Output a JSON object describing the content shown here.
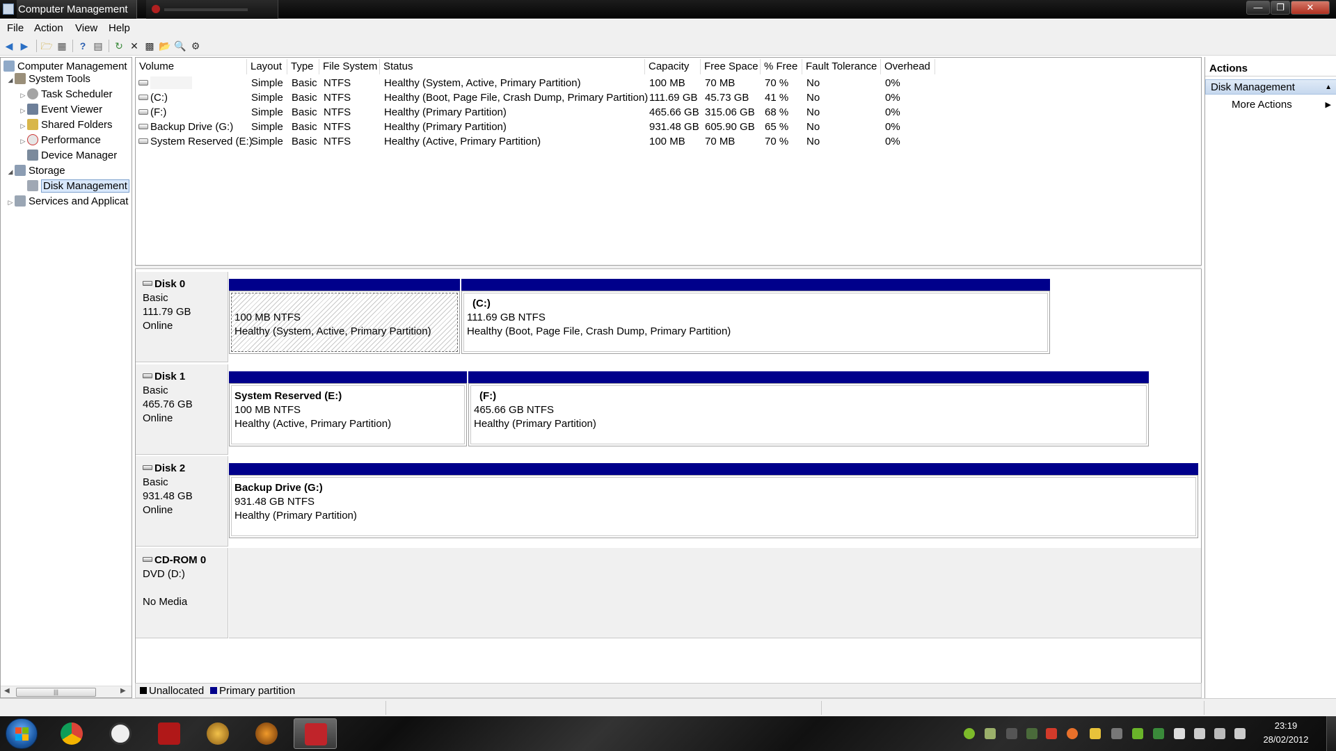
{
  "window": {
    "title": "Computer Management",
    "controls": [
      "minimize-icon",
      "maximize-icon",
      "close-icon"
    ]
  },
  "menu": [
    "File",
    "Action",
    "View",
    "Help"
  ],
  "toolbar": [
    "back-icon",
    "forward-icon",
    "up-folder-icon",
    "show-hide-tree-icon",
    "help-icon",
    "properties-icon",
    "refresh-icon",
    "delete-icon",
    "rescan-disks-icon",
    "open-icon",
    "search-icon",
    "settings-icon"
  ],
  "tree": [
    {
      "label": "Computer Management",
      "level": 0,
      "expander": "",
      "icon": "computer-management-icon"
    },
    {
      "label": "System Tools",
      "level": 1,
      "expander": "◢",
      "icon": "system-tools-icon"
    },
    {
      "label": "Task Scheduler",
      "level": 2,
      "expander": "▷",
      "icon": "task-scheduler-icon"
    },
    {
      "label": "Event Viewer",
      "level": 2,
      "expander": "▷",
      "icon": "event-viewer-icon"
    },
    {
      "label": "Shared Folders",
      "level": 2,
      "expander": "▷",
      "icon": "shared-folders-icon"
    },
    {
      "label": "Performance",
      "level": 2,
      "expander": "▷",
      "icon": "performance-icon"
    },
    {
      "label": "Device Manager",
      "level": 2,
      "expander": "",
      "icon": "device-manager-icon"
    },
    {
      "label": "Storage",
      "level": 1,
      "expander": "◢",
      "icon": "storage-icon"
    },
    {
      "label": "Disk Management",
      "level": 2,
      "expander": "",
      "icon": "disk-management-icon",
      "selected": true
    },
    {
      "label": "Services and Applicat",
      "level": 1,
      "expander": "▷",
      "icon": "services-icon"
    }
  ],
  "volume_table": {
    "columns": [
      "Volume",
      "Layout",
      "Type",
      "File System",
      "Status",
      "Capacity",
      "Free Space",
      "% Free",
      "Fault Tolerance",
      "Overhead"
    ],
    "rows": [
      [
        "",
        "Simple",
        "Basic",
        "NTFS",
        "Healthy (System, Active, Primary Partition)",
        "100 MB",
        "70 MB",
        "70 %",
        "No",
        "0%"
      ],
      [
        "(C:)",
        "Simple",
        "Basic",
        "NTFS",
        "Healthy (Boot, Page File, Crash Dump, Primary Partition)",
        "111.69 GB",
        "45.73 GB",
        "41 %",
        "No",
        "0%"
      ],
      [
        "(F:)",
        "Simple",
        "Basic",
        "NTFS",
        "Healthy (Primary Partition)",
        "465.66 GB",
        "315.06 GB",
        "68 %",
        "No",
        "0%"
      ],
      [
        "Backup Drive (G:)",
        "Simple",
        "Basic",
        "NTFS",
        "Healthy (Primary Partition)",
        "931.48 GB",
        "605.90 GB",
        "65 %",
        "No",
        "0%"
      ],
      [
        "System Reserved (E:)",
        "Simple",
        "Basic",
        "NTFS",
        "Healthy (Active, Primary Partition)",
        "100 MB",
        "70 MB",
        "70 %",
        "No",
        "0%"
      ]
    ]
  },
  "disks": [
    {
      "name": "Disk 0",
      "type": "Basic",
      "size": "111.79 GB",
      "status": "Online",
      "partitions": [
        {
          "name": "",
          "size": "100 MB NTFS",
          "status": "Healthy (System, Active, Primary Partition)",
          "hatched": true
        },
        {
          "name": "(C:)",
          "size": "111.69 GB NTFS",
          "status": "Healthy (Boot, Page File, Crash Dump, Primary Partition)"
        }
      ]
    },
    {
      "name": "Disk 1",
      "type": "Basic",
      "size": "465.76 GB",
      "status": "Online",
      "partitions": [
        {
          "name": "System Reserved  (E:)",
          "size": "100 MB NTFS",
          "status": "Healthy (Active, Primary Partition)"
        },
        {
          "name": "(F:)",
          "size": "465.66 GB NTFS",
          "status": "Healthy (Primary Partition)"
        }
      ]
    },
    {
      "name": "Disk 2",
      "type": "Basic",
      "size": "931.48 GB",
      "status": "Online",
      "partitions": [
        {
          "name": "Backup Drive  (G:)",
          "size": "931.48 GB NTFS",
          "status": "Healthy (Primary Partition)"
        }
      ]
    }
  ],
  "cdrom": {
    "name": "CD-ROM 0",
    "drive": "DVD (D:)",
    "status": "No Media"
  },
  "legend": [
    {
      "label": "Unallocated",
      "color": "#000000"
    },
    {
      "label": "Primary partition",
      "color": "#00008b"
    }
  ],
  "actions": {
    "header": "Actions",
    "section": "Disk Management",
    "items": [
      "More Actions"
    ]
  },
  "taskbar": {
    "apps": [
      "chrome-icon",
      "ubisoft-icon",
      "game-launcher-icon",
      "warcraft-icon",
      "game-icon",
      "computer-management-icon"
    ],
    "tray_icons": [
      "antivirus-icon",
      "network-monitor-icon",
      "keyboard-icon",
      "gpu-icon",
      "volume-app-icon",
      "firewall-icon",
      "camera-icon",
      "tools-icon",
      "nvidia-icon",
      "wifi-app-icon",
      "action-center-icon",
      "battery-icon",
      "network-icon",
      "speaker-icon"
    ],
    "time": "23:19",
    "date": "28/02/2012"
  }
}
